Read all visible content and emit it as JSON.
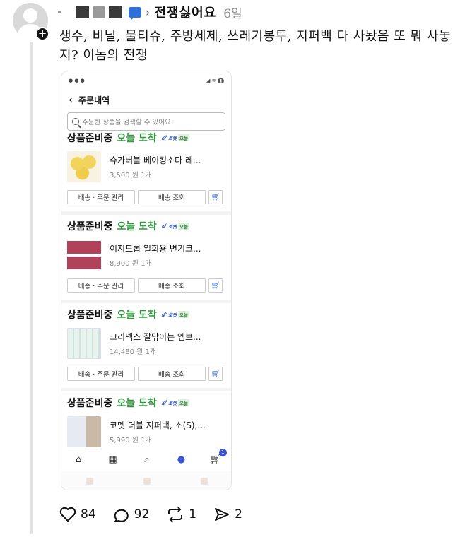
{
  "author": {
    "username": "전쟁싫어요",
    "time_ago": "6일"
  },
  "post": {
    "text": "생수, 비닐, 물티슈, 주방세제, 쓰레기봉투, 지퍼백 다 사놨음 또 뭐 사놓지? 이놈의 전쟁"
  },
  "screenshot": {
    "page_title": "주문내역",
    "search_placeholder": "주문한 상품을 검색할 수 있어요!",
    "status_label": "상품준비중",
    "arrival_label": "오늘 도착",
    "rocket_label": "로켓",
    "rocket_today": "오늘",
    "manage_button": "배송 · 주문 관리",
    "track_button": "배송 조회",
    "orders": [
      {
        "name": "슈가버블 베이킹소다 레...",
        "price": "3,500 원",
        "qty": "1개",
        "thumb": "thumb-lemon"
      },
      {
        "name": "이지드롭 일회용 변기크...",
        "price": "8,900 원",
        "qty": "1개",
        "thumb": "thumb-pink"
      },
      {
        "name": "크리넥스 잘닦이는 엠보...",
        "price": "14,480 원",
        "qty": "1개",
        "thumb": "thumb-wipes"
      },
      {
        "name": "코멧 더블 지퍼백, 소(S),...",
        "price": "5,990 원",
        "qty": "1개",
        "thumb": "thumb-zipper"
      }
    ],
    "cart_badge": "1"
  },
  "actions": {
    "likes": "84",
    "replies": "92",
    "reposts": "1",
    "shares": "2"
  },
  "colors": {
    "arrive_green": "#2e9a3c",
    "accent_blue": "#3a55d6"
  }
}
